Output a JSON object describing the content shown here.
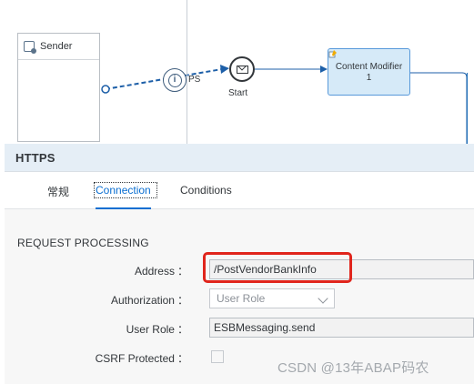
{
  "canvas": {
    "sender_label": "Sender",
    "adapter_text": "PS",
    "adapter_icon_glyph": "i",
    "start_label": "Start",
    "content_modifier_label": "Content Modifier",
    "content_modifier_number": "1"
  },
  "panel": {
    "title": "HTTPS",
    "tabs": [
      {
        "label": "常规",
        "active": false
      },
      {
        "label": "Connection",
        "active": true
      },
      {
        "label": "Conditions",
        "active": false
      }
    ],
    "section_title": "REQUEST PROCESSING",
    "fields": {
      "address": {
        "label": "Address",
        "value": "/PostVendorBankInfo"
      },
      "authorization": {
        "label": "Authorization",
        "value": "User Role"
      },
      "user_role": {
        "label": "User Role",
        "value": "ESBMessaging.send"
      },
      "csrf": {
        "label": "CSRF Protected",
        "checked": false
      }
    },
    "colon": "："
  },
  "watermark": "CSDN @13年ABAP码农",
  "colors": {
    "accent": "#0a6ed1",
    "highlight": "#e0251c",
    "flow_line": "#1d5fa8",
    "step_fill": "#d6eaf8"
  }
}
